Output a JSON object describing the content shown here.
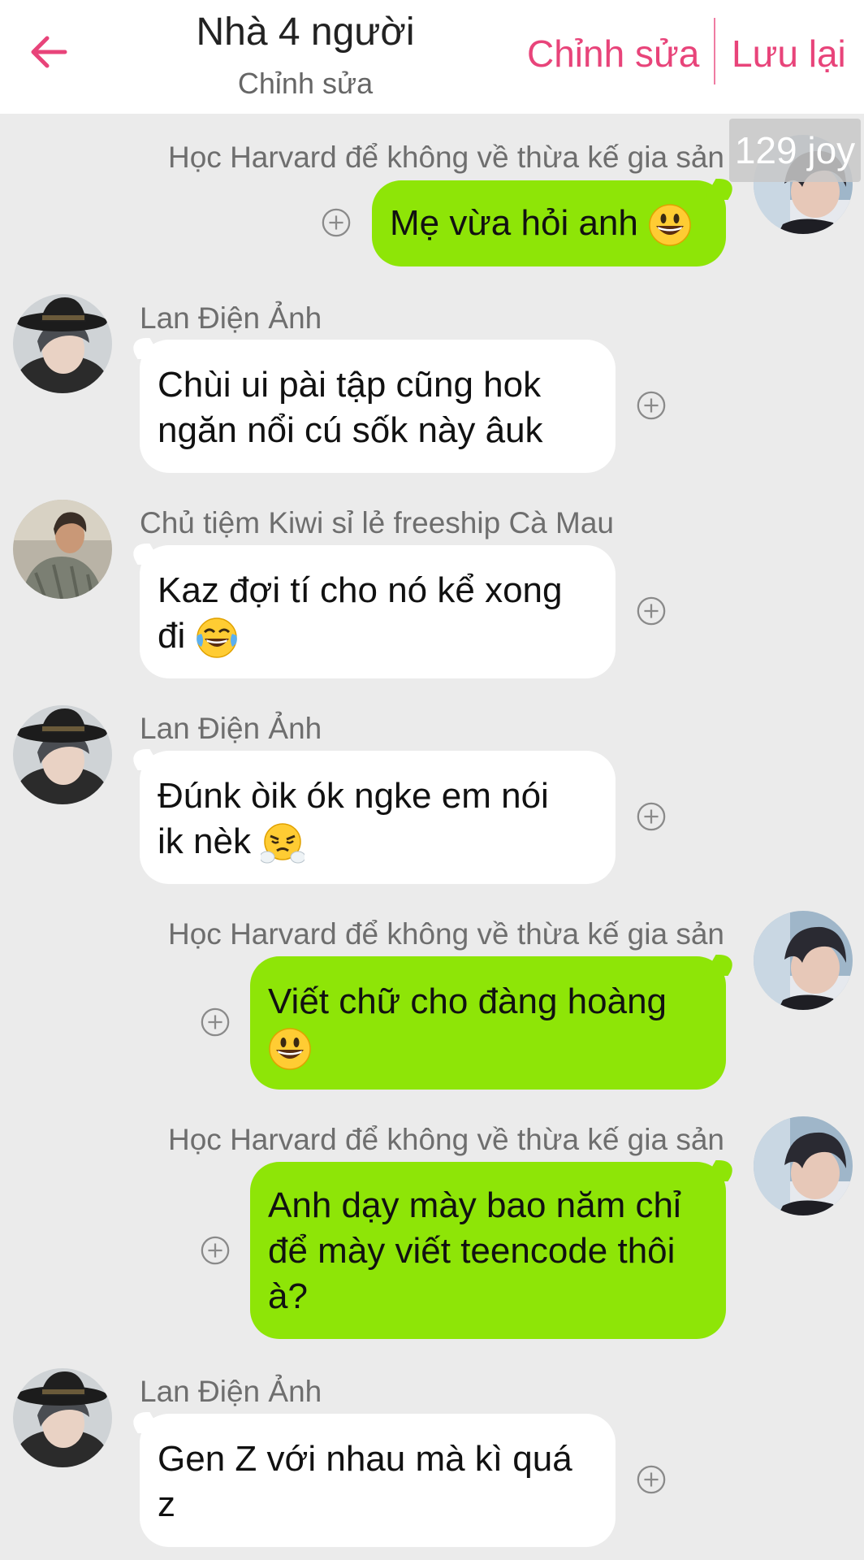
{
  "header": {
    "title": "Nhà 4 người",
    "subtitle": "Chỉnh sửa",
    "edit_label": "Chỉnh sửa",
    "save_label": "Lưu lại",
    "accent_color": "#e8447a"
  },
  "badge": {
    "text": "129 joy"
  },
  "messages": [
    {
      "sender": "Học Harvard để không về thừa kế gia sản",
      "text": "Mẹ vừa hỏi anh",
      "emoji": "grinning-face",
      "direction": "outgoing"
    },
    {
      "sender": "Lan Điện Ảnh",
      "line1": "Chùi ui pài tập cũng hok",
      "line2": "ngăn nổi cú sốk này âuk",
      "direction": "incoming"
    },
    {
      "sender": "Chủ tiệm Kiwi sỉ lẻ freeship Cà Mau",
      "line1": "Kaz đợi tí cho nó kể xong",
      "line2": "đi",
      "emoji": "tears-of-joy-face",
      "direction": "incoming"
    },
    {
      "sender": "Lan Điện Ảnh",
      "line1": "Đúnk òik ók ngke em nói",
      "line2": "ik nèk",
      "emoji": "steam-face",
      "direction": "incoming"
    },
    {
      "sender": "Học Harvard để không về thừa kế gia sản",
      "line1": "Viết chữ cho đàng hoàng",
      "emoji": "grinning-face",
      "direction": "outgoing"
    },
    {
      "sender": "Học Harvard để không về thừa kế gia sản",
      "line1": "Anh dạy mày bao năm chỉ",
      "line2": "để mày viết teencode thôi",
      "line3": "à?",
      "direction": "outgoing"
    },
    {
      "sender": "Lan Điện Ảnh",
      "line1": "Gen Z với nhau mà kì quá",
      "line2": "z",
      "direction": "incoming"
    }
  ],
  "colors": {
    "outgoing_bubble": "#8ee507",
    "incoming_bubble": "#ffffff",
    "background": "#ebebeb"
  }
}
